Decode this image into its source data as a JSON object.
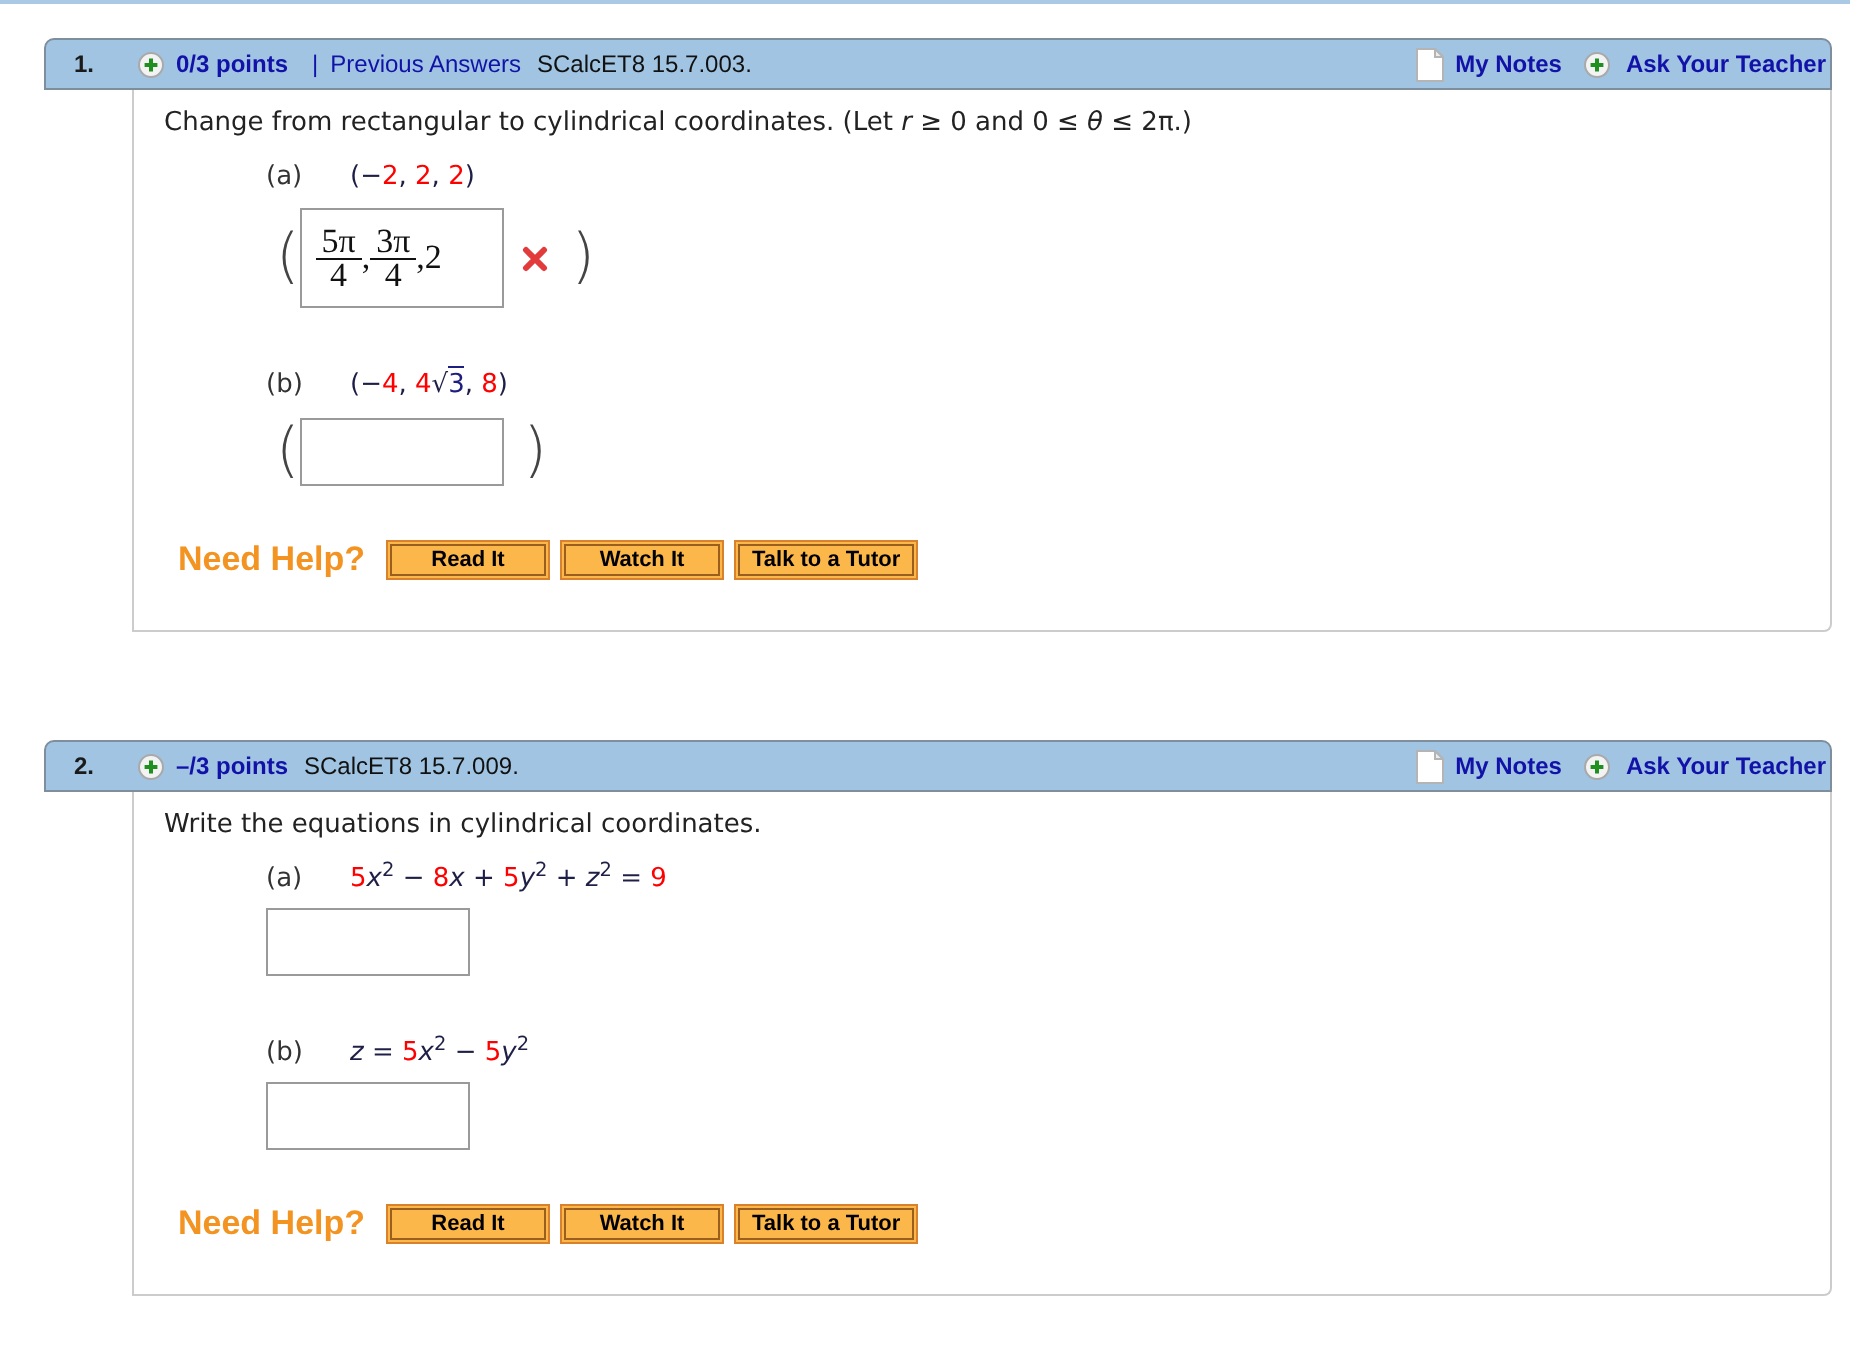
{
  "questions": [
    {
      "header": {
        "number": "1.",
        "points": "0/3 points",
        "separator": "|",
        "previous_answers": "Previous Answers",
        "source": "SCalcET8 15.7.003.",
        "notes_link": "My Notes",
        "teacher_link": "Ask Your Teacher"
      },
      "prompt": "Change from rectangular to cylindrical coordinates. (Let *r* ≥ 0 and 0 ≤ *θ* ≤ 2π.)",
      "parts": [
        {
          "label": "(a)",
          "expression": [
            {
              "kind": "text",
              "text": "(−",
              "color": "#1e1e46"
            },
            {
              "kind": "text",
              "text": "2",
              "color": "#ff0000"
            },
            {
              "kind": "text",
              "text": ", ",
              "color": "#1e1e46"
            },
            {
              "kind": "text",
              "text": "2",
              "color": "#ff0000"
            },
            {
              "kind": "text",
              "text": ", ",
              "color": "#1e1e46"
            },
            {
              "kind": "text",
              "text": "2",
              "color": "#ff0000"
            },
            {
              "kind": "text",
              "text": ")",
              "color": "#1e1e46"
            }
          ],
          "answer": {
            "open": "(",
            "close": ")",
            "correct": false,
            "terms": [
              {
                "kind": "fraction",
                "numerator": "5π",
                "denominator": "4"
              },
              {
                "kind": "text",
                "text": ","
              },
              {
                "kind": "fraction",
                "numerator": "3π",
                "denominator": "4"
              },
              {
                "kind": "text",
                "text": ",2"
              }
            ]
          }
        },
        {
          "label": "(b)",
          "expression": [
            {
              "kind": "text",
              "text": "(−",
              "color": "#1e1e46"
            },
            {
              "kind": "text",
              "text": "4",
              "color": "#ff0000"
            },
            {
              "kind": "text",
              "text": ", ",
              "color": "#1e1e46"
            },
            {
              "kind": "text",
              "text": "4",
              "color": "#ff0000"
            },
            {
              "kind": "text",
              "text": "√",
              "color": "#1e1e46"
            },
            {
              "kind": "radicand",
              "text": "3",
              "color": "#1e1e80"
            },
            {
              "kind": "text",
              "text": ", ",
              "color": "#1e1e46"
            },
            {
              "kind": "text",
              "text": "8",
              "color": "#ff0000"
            },
            {
              "kind": "text",
              "text": ")",
              "color": "#1e1e46"
            }
          ],
          "answer": {
            "open": "(",
            "close": ")"
          }
        }
      ],
      "help": {
        "label": "Need Help?",
        "buttons": [
          "Read It",
          "Watch It",
          "Talk to a Tutor"
        ]
      }
    },
    {
      "header": {
        "number": "2.",
        "points": "–/3 points",
        "source": "SCalcET8 15.7.009.",
        "notes_link": "My Notes",
        "teacher_link": "Ask Your Teacher"
      },
      "prompt": "Write the equations in cylindrical coordinates.",
      "parts": [
        {
          "label": "(a)",
          "expression": [
            {
              "kind": "text",
              "text": "5",
              "color": "#ff0000"
            },
            {
              "kind": "text",
              "text": "*x*$^{2}$ − ",
              "color": "#1e1e46"
            },
            {
              "kind": "text",
              "text": "8",
              "color": "#ff0000"
            },
            {
              "kind": "text",
              "text": "*x* + ",
              "color": "#1e1e46"
            },
            {
              "kind": "text",
              "text": "5",
              "color": "#ff0000"
            },
            {
              "kind": "text",
              "text": "*y*$^{2}$ + *z*$^{2}$ = ",
              "color": "#1e1e46"
            },
            {
              "kind": "text",
              "text": "9",
              "color": "#ff0000"
            }
          ]
        },
        {
          "label": "(b)",
          "expression": [
            {
              "kind": "text",
              "text": "*z* = ",
              "color": "#1e1e46"
            },
            {
              "kind": "text",
              "text": "5",
              "color": "#ff0000"
            },
            {
              "kind": "text",
              "text": "*x*$^{2}$ − ",
              "color": "#1e1e46"
            },
            {
              "kind": "text",
              "text": "5",
              "color": "#ff0000"
            },
            {
              "kind": "text",
              "text": "*y*$^{2}$",
              "color": "#1e1e46"
            }
          ]
        }
      ],
      "help": {
        "label": "Need Help?",
        "buttons": [
          "Read It",
          "Watch It",
          "Talk to a Tutor"
        ]
      }
    }
  ]
}
